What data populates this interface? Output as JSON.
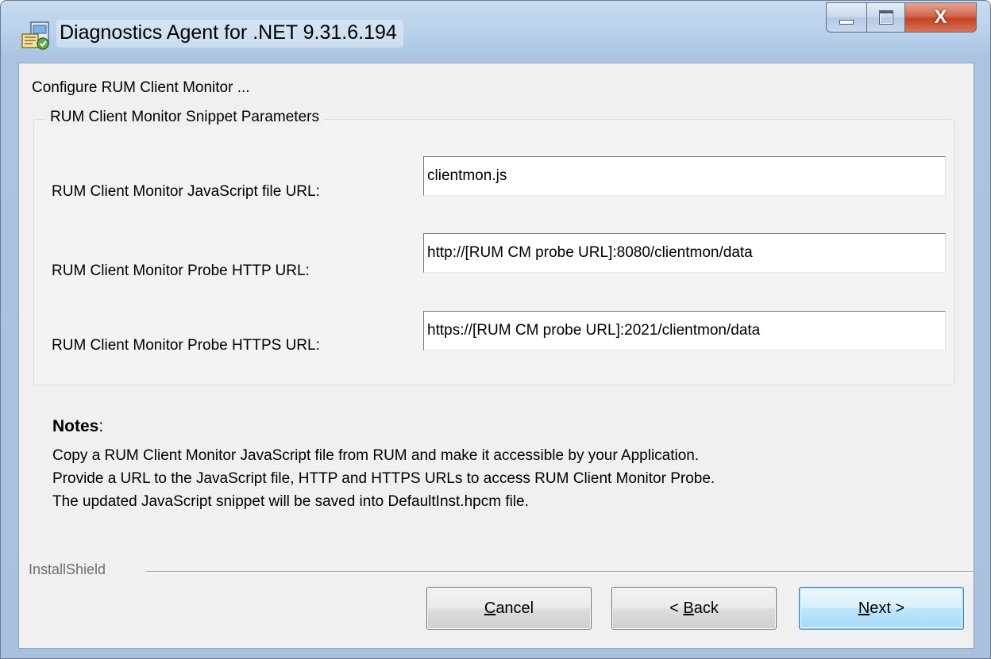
{
  "window": {
    "title": "Diagnostics Agent for .NET 9.31.6.194",
    "icons": {
      "app": "installer-app-icon",
      "minimize": "minimize-icon",
      "maximize": "maximize-icon",
      "close": "close-icon"
    },
    "close_glyph": "X"
  },
  "step_title": "Configure RUM Client Monitor ...",
  "group": {
    "legend": "RUM Client Monitor Snippet Parameters",
    "fields": [
      {
        "label": "RUM Client Monitor JavaScript file URL:",
        "value": "clientmon.js"
      },
      {
        "label": "RUM Client Monitor Probe HTTP URL:",
        "value": "http://[RUM CM probe URL]:8080/clientmon/data"
      },
      {
        "label": "RUM Client Monitor Probe HTTPS URL:",
        "value": "https://[RUM CM probe URL]:2021/clientmon/data"
      }
    ]
  },
  "notes": {
    "title": "Notes",
    "title_suffix": ":",
    "lines": [
      "Copy a RUM Client Monitor JavaScript file from RUM and make it accessible by your Application.",
      "Provide a URL to the JavaScript file, HTTP and HTTPS URLs to access RUM Client Monitor Probe.",
      "The updated JavaScript snippet will be saved into DefaultInst.hpcm file."
    ]
  },
  "footer": {
    "brand": "InstallShield"
  },
  "buttons": {
    "cancel": {
      "mnemonic": "C",
      "rest": "ancel"
    },
    "back": {
      "prefix": "< ",
      "mnemonic": "B",
      "rest": "ack"
    },
    "next": {
      "mnemonic": "N",
      "rest": "ext >"
    }
  }
}
